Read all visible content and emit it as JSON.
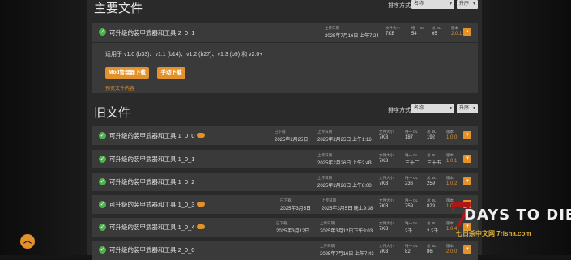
{
  "main_section": {
    "title": "主要文件",
    "sort_label": "排序方式",
    "sort_value": "名称",
    "order_value": "升序"
  },
  "main_file": {
    "name": "可升级的装甲武器和工具 2_0_1",
    "upload_label": "上传日期",
    "upload_date": "2025年7月16日 上午7:24",
    "size_label": "文件大小",
    "size": "7KB",
    "unique_label": "唯一 DL",
    "unique": "54",
    "total_label": "总 DL",
    "total": "65",
    "version_label": "版本",
    "version": "2.0.1",
    "compat": "适用于 v1.0 (b33)、v1.1 (b14)、v1.2 (b27)、v1.3 (b9) 和 v2.0+",
    "btn_mod": "Mod管理器下载",
    "btn_manual": "手动下载",
    "preview": "预览文件内容"
  },
  "old_section": {
    "title": "旧文件",
    "sort_label": "排序方式",
    "sort_value": "名称",
    "order_value": "升序"
  },
  "old_files": [
    {
      "name": "可升级的装甲武器和工具 1_0_0",
      "removed_label": "已下载",
      "removed": "2025年2月25日",
      "upload_label": "上传日期",
      "upload": "2025年2月25日 上午1:16",
      "size_label": "文件大小",
      "size": "7KB",
      "unique_label": "唯一 DL",
      "unique": "187",
      "total_label": "总 DL",
      "total": "192",
      "version_label": "版本",
      "version": "1.0.0"
    },
    {
      "name": "可升级的装甲武器和工具 1_0_1",
      "upload_label": "上传日期",
      "upload": "2025年2月26日 上午2:43",
      "size_label": "文件大小",
      "size": "7KB",
      "unique_label": "唯一 DL",
      "unique": "三十二",
      "total_label": "总 DL",
      "total": "三十五",
      "version_label": "版本",
      "version": "1.0.1"
    },
    {
      "name": "可升级的装甲武器和工具 1_0_2",
      "upload_label": "上传日期",
      "upload": "2025年2月26日 上午8:00",
      "size_label": "文件大小",
      "size": "7KB",
      "unique_label": "唯一 DL",
      "unique": "236",
      "total_label": "总 DL",
      "total": "259",
      "version_label": "版本",
      "version": "1.0.2"
    },
    {
      "name": "可升级的装甲武器和工具 1_0_3",
      "removed_label": "已下载",
      "removed": "2025年3月5日",
      "upload_label": "上传日期",
      "upload": "2025年3月5日 晚上9:38",
      "size_label": "文件大小",
      "size": "7KB",
      "unique_label": "唯一 DL",
      "unique": "759",
      "total_label": "总 DL",
      "total": "829",
      "version_label": "版本",
      "version": "1.0.3"
    },
    {
      "name": "可升级的装甲武器和工具 1_0_4",
      "removed_label": "已下载",
      "removed": "2025年3月12日",
      "upload_label": "上传日期",
      "upload": "2025年3月12日下午9:03",
      "size_label": "文件大小",
      "size": "7KB",
      "unique_label": "唯一 DL",
      "unique": "2千",
      "total_label": "总 DL",
      "total": "2.2千",
      "version_label": "版本",
      "version": "1.0.4"
    },
    {
      "name": "可升级的装甲武器和工具 2_0_0",
      "upload_label": "上传日期",
      "upload": "2025年7月16日 上午7:43",
      "size_label": "文件大小",
      "size": "7KB",
      "unique_label": "唯一 DL",
      "unique": "82",
      "total_label": "总 DL",
      "total": "86",
      "version_label": "版本",
      "version": "2.0.0"
    }
  ],
  "logo": {
    "seven": "7",
    "main": "DAYS TO DIE",
    "sub": "七日杀中文网 7risha.com"
  },
  "colors": {
    "accent": "#e2912b",
    "check": "#4fb24f",
    "row": "#3a3a3a",
    "panel": "#2a2a2a"
  }
}
